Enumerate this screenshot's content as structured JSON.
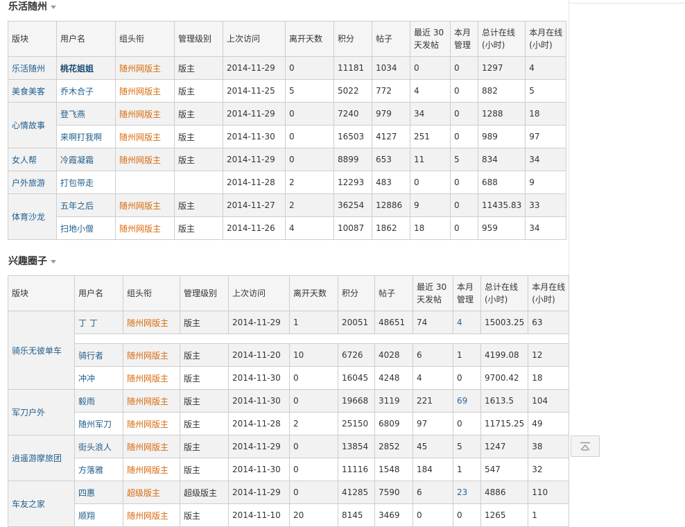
{
  "sections": [
    {
      "title": "乐活随州",
      "headers": [
        "版块",
        "用户名",
        "组头衔",
        "管理级别",
        "上次访问",
        "离开天数",
        "积分",
        "帖子",
        "最近 30 天发帖",
        "本月管理",
        "总计在线 (小时)",
        "本月在线 (小时)"
      ],
      "rows": [
        {
          "board": "乐活随州",
          "user": "桃花姐姐",
          "title": "随州网版主",
          "level": "版主",
          "last": "2014-11-29",
          "days": "0",
          "points": "11181",
          "posts": "1034",
          "recent": "0",
          "manage": "0",
          "total": "1297",
          "month": "4"
        },
        {
          "board": "美食美客",
          "user": "乔木合子",
          "title": "随州网版主",
          "level": "版主",
          "last": "2014-11-25",
          "days": "5",
          "points": "5022",
          "posts": "772",
          "recent": "4",
          "manage": "0",
          "total": "882",
          "month": "5"
        },
        {
          "board": "心情故事",
          "user": "登飞燕",
          "title": "随州网版主",
          "level": "版主",
          "last": "2014-11-29",
          "days": "0",
          "points": "7240",
          "posts": "979",
          "recent": "34",
          "manage": "0",
          "total": "1288",
          "month": "18"
        },
        {
          "board": "",
          "user": "来啊打我啊",
          "title": "随州网版主",
          "level": "版主",
          "last": "2014-11-30",
          "days": "0",
          "points": "16503",
          "posts": "4127",
          "recent": "251",
          "manage": "0",
          "total": "989",
          "month": "97"
        },
        {
          "board": "女人帮",
          "user": "冷霞凝霜",
          "title": "随州网版主",
          "level": "版主",
          "last": "2014-11-29",
          "days": "0",
          "points": "8899",
          "posts": "653",
          "recent": "11",
          "manage": "5",
          "total": "834",
          "month": "34"
        },
        {
          "board": "户外旅游",
          "user": "打包带走",
          "title": "",
          "level": "",
          "last": "2014-11-28",
          "days": "2",
          "points": "12293",
          "posts": "483",
          "recent": "0",
          "manage": "0",
          "total": "688",
          "month": "9"
        },
        {
          "board": "体育沙龙",
          "user": "五年之后",
          "title": "随州网版主",
          "level": "版主",
          "last": "2014-11-27",
          "days": "2",
          "points": "36254",
          "posts": "12886",
          "recent": "9",
          "manage": "0",
          "total": "11435.83",
          "month": "33"
        },
        {
          "board": "",
          "user": "扫地小僧",
          "title": "随州网版主",
          "level": "版主",
          "last": "2014-11-26",
          "days": "4",
          "points": "10087",
          "posts": "1862",
          "recent": "18",
          "manage": "0",
          "total": "959",
          "month": "34"
        }
      ]
    },
    {
      "title": "兴趣圈子",
      "headers": [
        "版块",
        "用户名",
        "组头衔",
        "管理级别",
        "上次访问",
        "离开天数",
        "积分",
        "帖子",
        "最近 30 天发帖",
        "本月管理",
        "总计在线 (小时)",
        "本月在线 (小时)"
      ],
      "rows": [
        {
          "board": "骑乐无彼单车",
          "user": "丁 丁",
          "title": "随州网版主",
          "level": "版主",
          "last": "2014-11-29",
          "days": "1",
          "points": "20051",
          "posts": "48651",
          "recent": "74",
          "manage": "4",
          "total": "15003.25",
          "month": "63"
        },
        {
          "board": "",
          "user": "骑行者",
          "title": "随州网版主",
          "level": "版主",
          "last": "2014-11-20",
          "days": "10",
          "points": "6726",
          "posts": "4028",
          "recent": "6",
          "manage": "1",
          "total": "4199.08",
          "month": "12"
        },
        {
          "board": "",
          "user": "冲冲",
          "title": "随州网版主",
          "level": "版主",
          "last": "2014-11-30",
          "days": "0",
          "points": "16045",
          "posts": "4248",
          "recent": "4",
          "manage": "0",
          "total": "9700.42",
          "month": "18"
        },
        {
          "board": "军刀户外",
          "user": "毅雨",
          "title": "随州网版主",
          "level": "版主",
          "last": "2014-11-30",
          "days": "0",
          "points": "19668",
          "posts": "3119",
          "recent": "221",
          "manage": "69",
          "total": "1613.5",
          "month": "104"
        },
        {
          "board": "",
          "user": "随州军刀",
          "title": "随州网版主",
          "level": "版主",
          "last": "2014-11-28",
          "days": "2",
          "points": "25150",
          "posts": "6809",
          "recent": "97",
          "manage": "0",
          "total": "11715.25",
          "month": "49"
        },
        {
          "board": "逍遥游摩旅团",
          "user": "街头浪人",
          "title": "随州网版主",
          "level": "版主",
          "last": "2014-11-29",
          "days": "0",
          "points": "13854",
          "posts": "2852",
          "recent": "45",
          "manage": "5",
          "total": "1247",
          "month": "38"
        },
        {
          "board": "",
          "user": "方落雅",
          "title": "随州网版主",
          "level": "版主",
          "last": "2014-11-30",
          "days": "0",
          "points": "11116",
          "posts": "1548",
          "recent": "184",
          "manage": "1",
          "total": "547",
          "month": "32"
        },
        {
          "board": "车友之家",
          "user": "四惠",
          "title": "超级版主",
          "level": "超级版主",
          "last": "2014-11-29",
          "days": "0",
          "points": "41285",
          "posts": "7590",
          "recent": "6",
          "manage": "23",
          "total": "4886",
          "month": "110"
        },
        {
          "board": "",
          "user": "顺翔",
          "title": "随州网版主",
          "level": "版主",
          "last": "2014-11-10",
          "days": "20",
          "points": "8145",
          "posts": "3469",
          "recent": "0",
          "manage": "0",
          "total": "1265",
          "month": "1"
        }
      ]
    }
  ],
  "icons": {
    "back_to_top": "back-to-top-icon"
  }
}
